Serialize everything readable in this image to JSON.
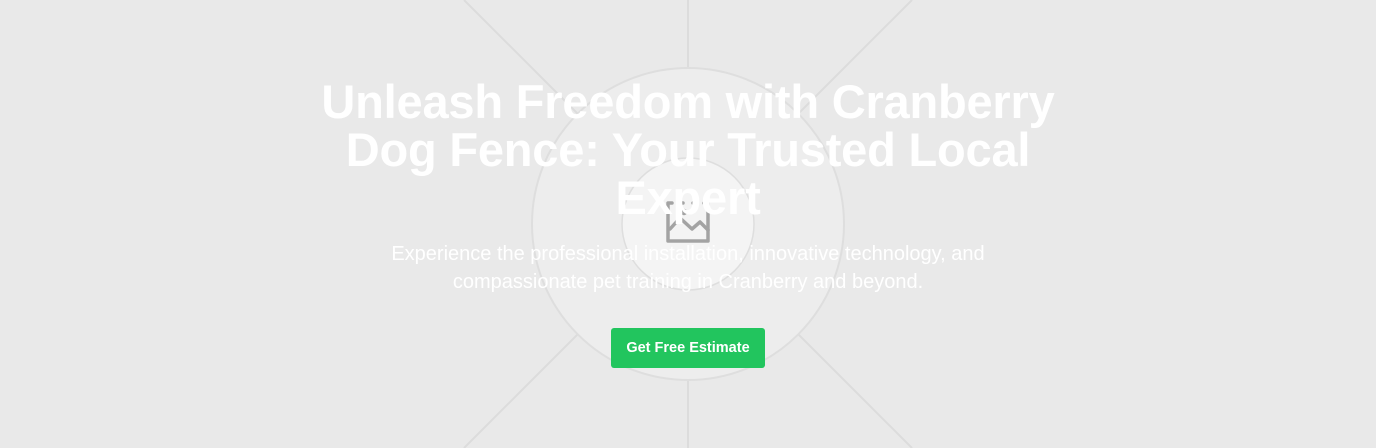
{
  "hero": {
    "background_color": "#e9e9e9",
    "placeholder_icon": "image-icon",
    "headline": "Unleash Freedom with Cranberry Dog Fence: Your Trusted Local Expert",
    "subheadline": "Experience the professional installation, innovative technology, and compassionate pet training in Cranberry and beyond.",
    "cta_label": "Get Free Estimate",
    "cta_color": "#22c55e"
  }
}
